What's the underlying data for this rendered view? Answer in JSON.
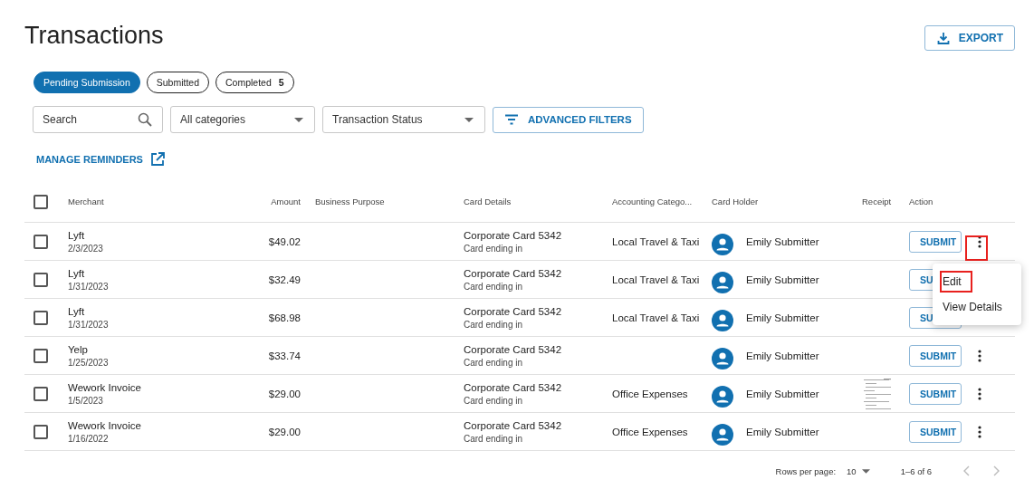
{
  "page": {
    "title": "Transactions",
    "export_button": "EXPORT"
  },
  "tabs": [
    {
      "label": "Pending Submission",
      "selected": true
    },
    {
      "label": "Submitted",
      "selected": false
    },
    {
      "label": "Completed",
      "count": "5",
      "selected": false
    }
  ],
  "filters": {
    "search": {
      "placeholder": "Search"
    },
    "category": "All categories",
    "status": "Transaction Status",
    "advanced_button": "ADVANCED FILTERS"
  },
  "manage_reminders_link": "MANAGE REMINDERS",
  "table": {
    "columns": [
      "Merchant",
      "Amount",
      "Business Purpose",
      "Card Details",
      "Accounting Catego...",
      "Card Holder",
      "Receipt",
      "Action"
    ],
    "header_checked": false,
    "rows": [
      {
        "checked": false,
        "merchant": "Lyft",
        "date": "2/3/2023",
        "amount": "$49.02",
        "card": "Corporate Card 5342",
        "card_sub": "Card ending in",
        "category": "Local Travel & Taxi",
        "holder": "Emily Submitter",
        "action": "SUBMIT"
      },
      {
        "checked": false,
        "merchant": "Lyft",
        "date": "1/31/2023",
        "amount": "$32.49",
        "card": "Corporate Card 5342",
        "card_sub": "Card ending in",
        "category": "Local Travel & Taxi",
        "holder": "Emily Submitter",
        "action": "SU"
      },
      {
        "checked": false,
        "merchant": "Lyft",
        "date": "1/31/2023",
        "amount": "$68.98",
        "card": "Corporate Card 5342",
        "card_sub": "Card ending in",
        "category": "Local Travel & Taxi",
        "holder": "Emily Submitter",
        "action": "SU"
      },
      {
        "checked": false,
        "merchant": "Yelp",
        "date": "1/25/2023",
        "amount": "$33.74",
        "card": "Corporate Card 5342",
        "card_sub": "Card ending in",
        "holder": "Emily Submitter",
        "action": "SUBMIT"
      },
      {
        "checked": false,
        "merchant": "Wework Invoice",
        "date": "1/5/2023",
        "amount": "$29.00",
        "card": "Corporate Card 5342",
        "card_sub": "Card ending in",
        "category": "Office Expenses",
        "holder": "Emily Submitter",
        "action": "SUBMIT"
      },
      {
        "checked": false,
        "merchant": "Wework Invoice",
        "date": "1/16/2022",
        "amount": "$29.00",
        "card": "Corporate Card 5342",
        "card_sub": "Card ending in",
        "category": "Office Expenses",
        "holder": "Emily Submitter",
        "action": "SUBMIT"
      }
    ]
  },
  "row_menu": {
    "trigger_highlighted": true,
    "items": [
      {
        "label": "Edit",
        "highlighted": true
      },
      {
        "label": "View Details",
        "highlighted": false
      }
    ]
  },
  "pagination": {
    "rows_label": "Rows per page:",
    "rows_value": "10",
    "range": "1–6 of 6",
    "prev_disabled": true,
    "next_disabled": true
  }
}
